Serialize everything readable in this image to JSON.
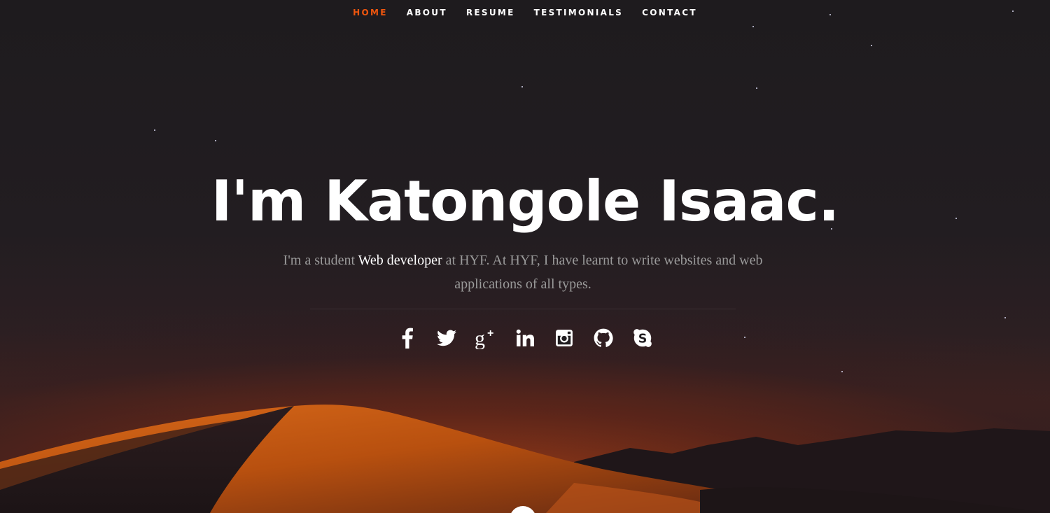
{
  "nav": {
    "items": [
      {
        "label": "HOME",
        "active": true
      },
      {
        "label": "ABOUT"
      },
      {
        "label": "RESUME"
      },
      {
        "label": "TESTIMONIALS"
      },
      {
        "label": "CONTACT"
      }
    ]
  },
  "hero": {
    "headline": "I'm Katongole Isaac.",
    "intro_prefix": "I'm a student ",
    "intro_highlight": "Web developer",
    "intro_suffix": " at HYF. At HYF, I have learnt to write websites and web applications of all types."
  },
  "social": {
    "icons": [
      "facebook-icon",
      "twitter-icon",
      "google-plus-icon",
      "linkedin-icon",
      "instagram-icon",
      "github-icon",
      "skype-icon"
    ]
  },
  "colors": {
    "accent": "#f0560e",
    "background": "#201d20",
    "text_muted": "#9a9a9a"
  }
}
